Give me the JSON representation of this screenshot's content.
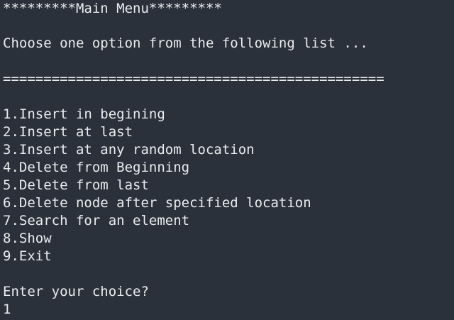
{
  "terminal": {
    "title_line": "*********Main Menu*********",
    "prompt_line": "Choose one option from the following list ...",
    "separator_line": "===============================================",
    "menu_items": [
      "1.Insert in begining",
      "2.Insert at last",
      "3.Insert at any random location",
      "4.Delete from Beginning",
      "5.Delete from last",
      "6.Delete node after specified location",
      "7.Search for an element",
      "8.Show",
      "9.Exit"
    ],
    "choice_prompt": "Enter your choice?",
    "user_input": "1"
  },
  "colors": {
    "background": "#2b313b",
    "text": "#e9ecef"
  }
}
